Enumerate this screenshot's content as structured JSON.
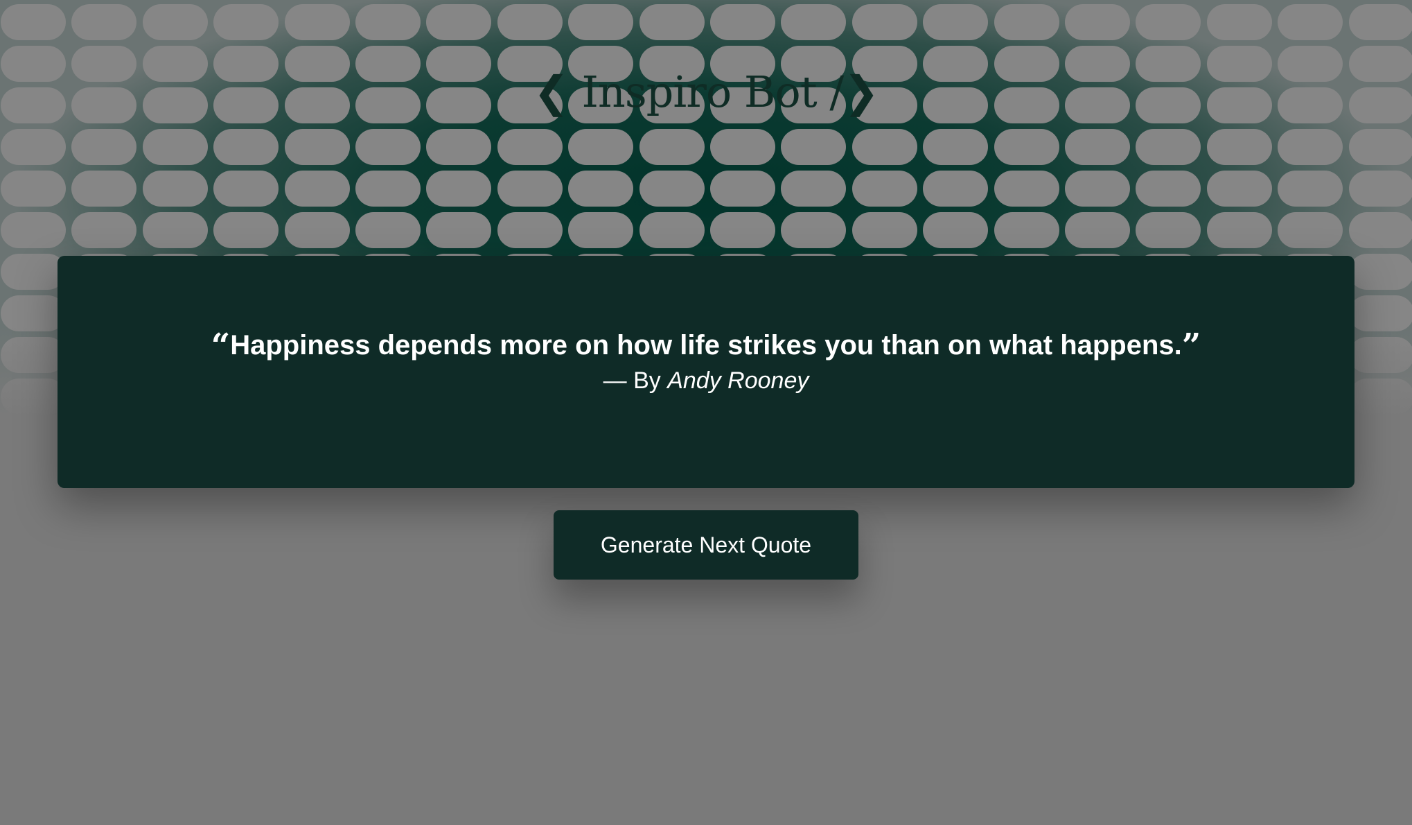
{
  "app": {
    "title": "❮ Inspiro Bot /❯"
  },
  "quote": {
    "open_mark": "“",
    "text": "Happiness depends more on how life strikes you than on what happens.",
    "close_mark": "”",
    "author_prefix": "— By",
    "author": "Andy Rooney"
  },
  "actions": {
    "next_label": "Generate Next Quote"
  },
  "colors": {
    "page_background": "#7a7a7a",
    "pill": "#868686",
    "card_background": "#0f2b27",
    "title_color": "#0f2c25",
    "text_color": "#ffffff"
  }
}
